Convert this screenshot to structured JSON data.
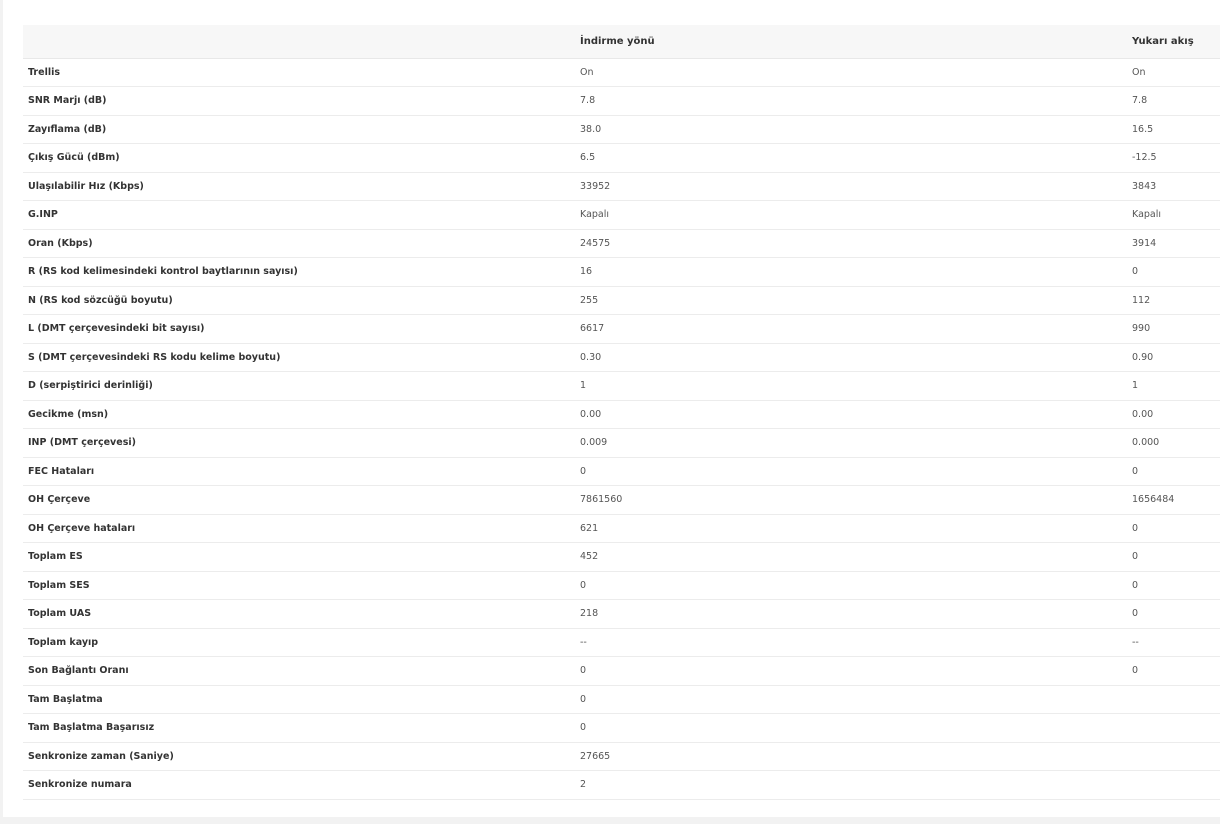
{
  "table": {
    "headers": {
      "label": "",
      "down": "İndirme yönü",
      "up": "Yukarı akış"
    },
    "rows": [
      {
        "label": "Trellis",
        "down": "On",
        "up": "On"
      },
      {
        "label": "SNR Marjı (dB)",
        "down": "7.8",
        "up": "7.8"
      },
      {
        "label": "Zayıflama (dB)",
        "down": "38.0",
        "up": "16.5"
      },
      {
        "label": "Çıkış Gücü (dBm)",
        "down": "6.5",
        "up": "-12.5"
      },
      {
        "label": "Ulaşılabilir Hız (Kbps)",
        "down": "33952",
        "up": "3843"
      },
      {
        "label": "G.INP",
        "down": "Kapalı",
        "up": "Kapalı"
      },
      {
        "label": "Oran (Kbps)",
        "down": "24575",
        "up": "3914"
      },
      {
        "label": "R (RS kod kelimesindeki kontrol baytlarının sayısı)",
        "down": "16",
        "up": "0"
      },
      {
        "label": "N (RS kod sözcüğü boyutu)",
        "down": "255",
        "up": "112"
      },
      {
        "label": "L (DMT çerçevesindeki bit sayısı)",
        "down": "6617",
        "up": "990"
      },
      {
        "label": "S (DMT çerçevesindeki RS kodu kelime boyutu)",
        "down": "0.30",
        "up": "0.90"
      },
      {
        "label": "D (serpiştirici derinliği)",
        "down": "1",
        "up": "1"
      },
      {
        "label": "Gecikme (msn)",
        "down": "0.00",
        "up": "0.00"
      },
      {
        "label": "INP (DMT çerçevesi)",
        "down": "0.009",
        "up": "0.000"
      },
      {
        "label": "FEC Hataları",
        "down": "0",
        "up": "0"
      },
      {
        "label": "OH Çerçeve",
        "down": "7861560",
        "up": "1656484"
      },
      {
        "label": "OH Çerçeve hataları",
        "down": "621",
        "up": "0"
      },
      {
        "label": "Toplam ES",
        "down": "452",
        "up": "0"
      },
      {
        "label": "Toplam SES",
        "down": "0",
        "up": "0"
      },
      {
        "label": "Toplam UAS",
        "down": "218",
        "up": "0"
      },
      {
        "label": "Toplam kayıp",
        "down": "--",
        "up": "--"
      },
      {
        "label": "Son Bağlantı Oranı",
        "down": "0",
        "up": "0"
      },
      {
        "label": "Tam Başlatma",
        "down": "0",
        "up": ""
      },
      {
        "label": "Tam Başlatma Başarısız",
        "down": "0",
        "up": ""
      },
      {
        "label": "Senkronize zaman (Saniye)",
        "down": "27665",
        "up": ""
      },
      {
        "label": "Senkronize numara",
        "down": "2",
        "up": ""
      }
    ]
  }
}
